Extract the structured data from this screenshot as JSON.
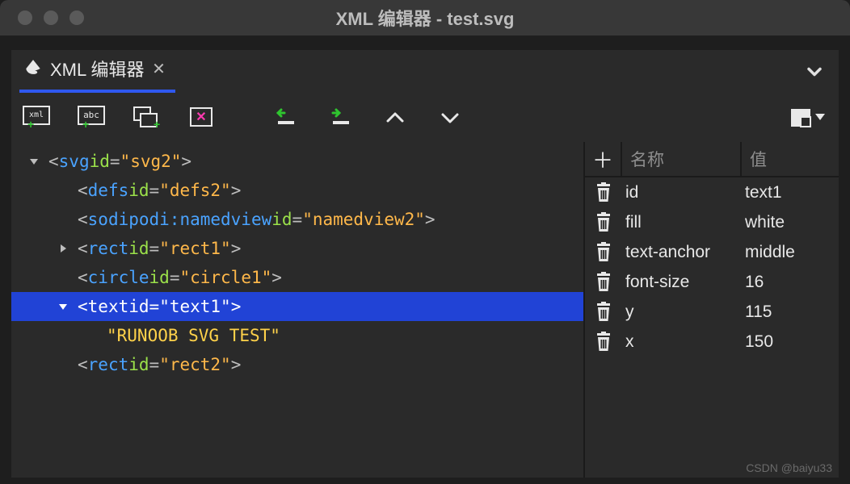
{
  "window": {
    "title": "XML 编辑器 - test.svg"
  },
  "tab": {
    "label": "XML 编辑器"
  },
  "tree": [
    {
      "depth": 0,
      "expander": "down",
      "tag": "svg",
      "attr": "id",
      "val": "\"svg2\"",
      "selected": false
    },
    {
      "depth": 1,
      "expander": "",
      "tag": "defs",
      "attr": "id",
      "val": "\"defs2\"",
      "selected": false
    },
    {
      "depth": 1,
      "expander": "",
      "tag": "sodipodi:namedview",
      "attr": "id",
      "val": "\"namedview2\"",
      "selected": false
    },
    {
      "depth": 1,
      "expander": "right",
      "tag": "rect",
      "attr": "id",
      "val": "\"rect1\"",
      "selected": false
    },
    {
      "depth": 1,
      "expander": "",
      "tag": "circle",
      "attr": "id",
      "val": "\"circle1\"",
      "selected": false
    },
    {
      "depth": 1,
      "expander": "down",
      "tag": "text",
      "attr": "id",
      "val": "\"text1\"",
      "selected": true
    },
    {
      "depth": 2,
      "expander": "",
      "text": "\"RUNOOB SVG TEST\"",
      "selected": false
    },
    {
      "depth": 1,
      "expander": "",
      "tag": "rect",
      "attr": "id",
      "val": "\"rect2\"",
      "selected": false
    }
  ],
  "side": {
    "name_header": "名称",
    "value_header": "值",
    "rows": [
      {
        "name": "id",
        "value": "text1"
      },
      {
        "name": "fill",
        "value": "white"
      },
      {
        "name": "text-anchor",
        "value": "middle"
      },
      {
        "name": "font-size",
        "value": "16"
      },
      {
        "name": "y",
        "value": "115"
      },
      {
        "name": "x",
        "value": "150"
      }
    ]
  },
  "watermark": "CSDN @baiyu33"
}
